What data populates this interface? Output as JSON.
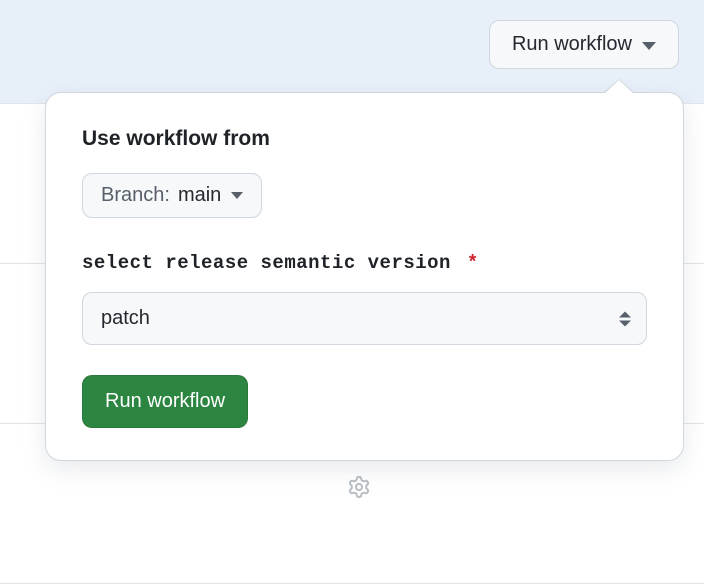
{
  "trigger": {
    "label": "Run workflow"
  },
  "popover": {
    "use_workflow_from_label": "Use workflow from",
    "branch_prefix": "Branch:",
    "branch_name": "main",
    "input_label": "select release semantic version",
    "required_mark": "*",
    "selected_version": "patch",
    "submit_label": "Run workflow"
  }
}
